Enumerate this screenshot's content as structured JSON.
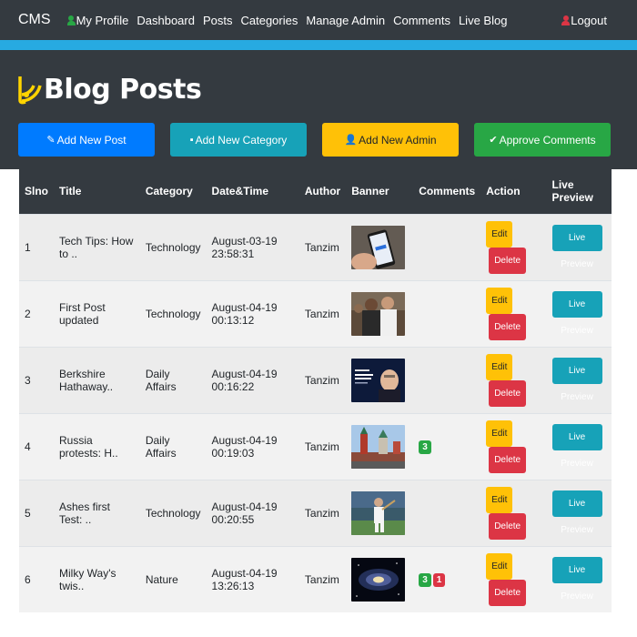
{
  "navbar": {
    "brand": "CMS",
    "items": [
      "My Profile",
      "Dashboard",
      "Posts",
      "Categories",
      "Manage Admin",
      "Comments",
      "Live Blog"
    ],
    "logout": "Logout"
  },
  "header": {
    "title": "Blog Posts",
    "buttons": {
      "add_post": "Add New Post",
      "add_category": "Add New Category",
      "add_admin": "Add New Admin",
      "approve": "Approve Comments"
    }
  },
  "table": {
    "columns": [
      "Slno",
      "Title",
      "Category",
      "Date&Time",
      "Author",
      "Banner",
      "Comments",
      "Action",
      "Live Preview"
    ],
    "edit_label": "Edit",
    "delete_label": "Delete",
    "preview_label": "Live Preview",
    "rows": [
      {
        "slno": "1",
        "title": "Tech Tips: How to ..",
        "category": "Technology",
        "datetime": "August-03-19 23:58:31",
        "author": "Tanzim",
        "approved": "",
        "pending": ""
      },
      {
        "slno": "2",
        "title": "First Post updated",
        "category": "Technology",
        "datetime": "August-04-19 00:13:12",
        "author": "Tanzim",
        "approved": "",
        "pending": ""
      },
      {
        "slno": "3",
        "title": "Berkshire Hathaway..",
        "category": "Daily Affairs",
        "datetime": "August-04-19 00:16:22",
        "author": "Tanzim",
        "approved": "",
        "pending": ""
      },
      {
        "slno": "4",
        "title": "Russia protests: H..",
        "category": "Daily Affairs",
        "datetime": "August-04-19 00:19:03",
        "author": "Tanzim",
        "approved": "3",
        "pending": ""
      },
      {
        "slno": "5",
        "title": "Ashes first Test: ..",
        "category": "Technology",
        "datetime": "August-04-19 00:20:55",
        "author": "Tanzim",
        "approved": "",
        "pending": ""
      },
      {
        "slno": "6",
        "title": "Milky Way's twis..",
        "category": "Nature",
        "datetime": "August-04-19 13:26:13",
        "author": "Tanzim",
        "approved": "3",
        "pending": "1"
      }
    ]
  },
  "colors": {
    "dark": "#343a40",
    "stripe": "#27aae1",
    "primary": "#007bff",
    "info": "#17a2b8",
    "warning": "#ffc107",
    "success": "#28a745",
    "danger": "#dc3545"
  }
}
